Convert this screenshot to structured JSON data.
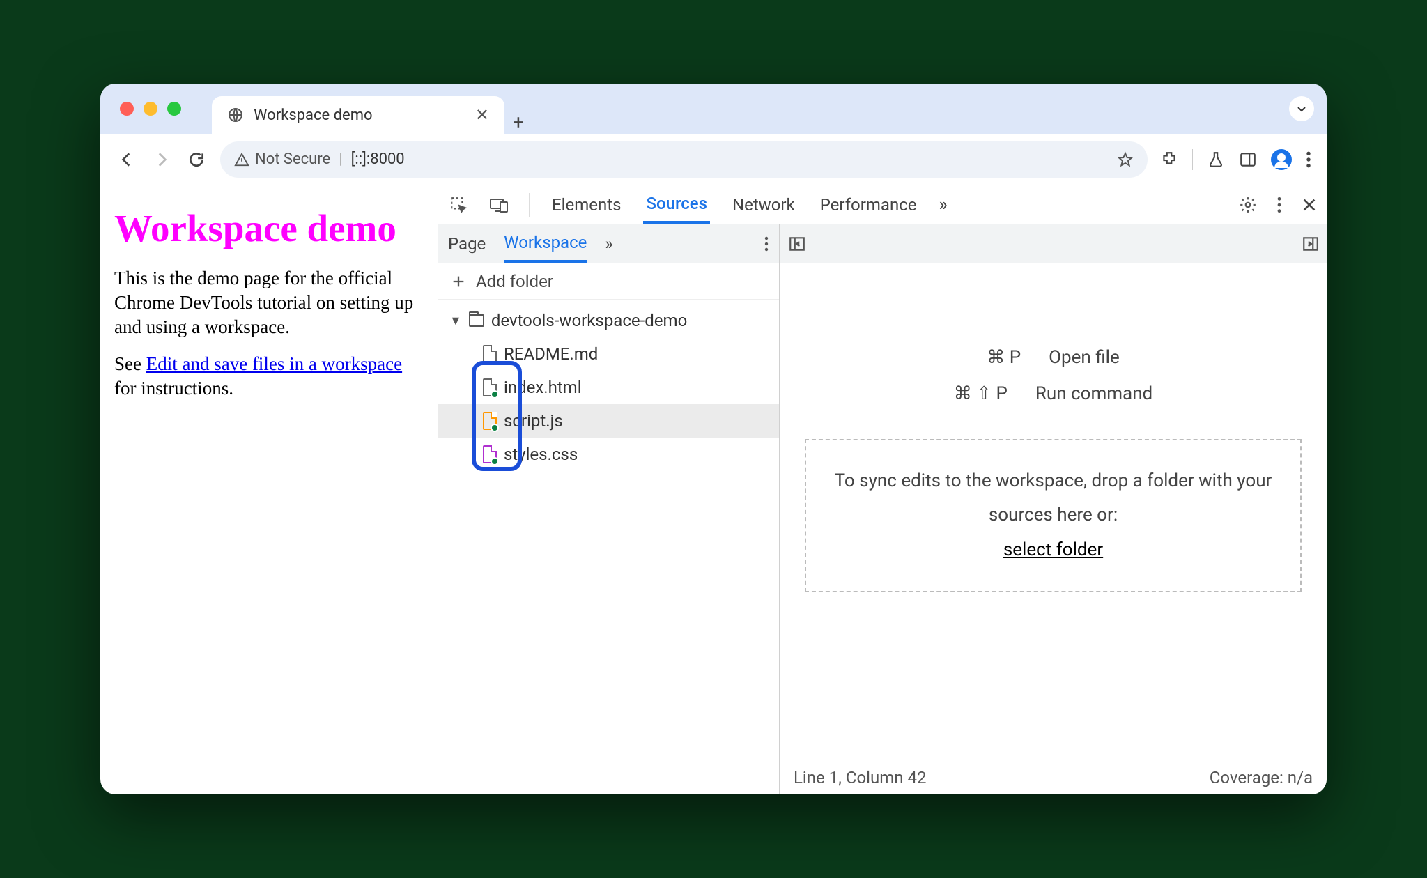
{
  "browser": {
    "tab_title": "Workspace demo",
    "security_label": "Not Secure",
    "url": "[::]:8000"
  },
  "page": {
    "heading": "Workspace demo",
    "para1": "This is the demo page for the official Chrome DevTools tutorial on setting up and using a workspace.",
    "para2_prefix": "See ",
    "para2_link": "Edit and save files in a workspace",
    "para2_suffix": " for instructions."
  },
  "devtools": {
    "main_tabs": [
      "Elements",
      "Sources",
      "Network",
      "Performance"
    ],
    "active_main_tab": "Sources",
    "sub_tabs": [
      "Page",
      "Workspace"
    ],
    "active_sub_tab": "Workspace",
    "add_folder_label": "Add folder",
    "folder_name": "devtools-workspace-demo",
    "files": [
      {
        "name": "README.md",
        "icon": "gray",
        "dot": false
      },
      {
        "name": "index.html",
        "icon": "gray",
        "dot": true
      },
      {
        "name": "script.js",
        "icon": "orange",
        "dot": true,
        "selected": true
      },
      {
        "name": "styles.css",
        "icon": "purple",
        "dot": true
      }
    ],
    "hints": {
      "open_file_kbd": "⌘ P",
      "open_file_label": "Open file",
      "run_cmd_kbd": "⌘ ⇧ P",
      "run_cmd_label": "Run command"
    },
    "dropzone": {
      "line": "To sync edits to the workspace, drop a folder with your sources here or:",
      "link": "select folder"
    },
    "status": {
      "cursor": "Line 1, Column 42",
      "coverage": "Coverage: n/a"
    }
  }
}
